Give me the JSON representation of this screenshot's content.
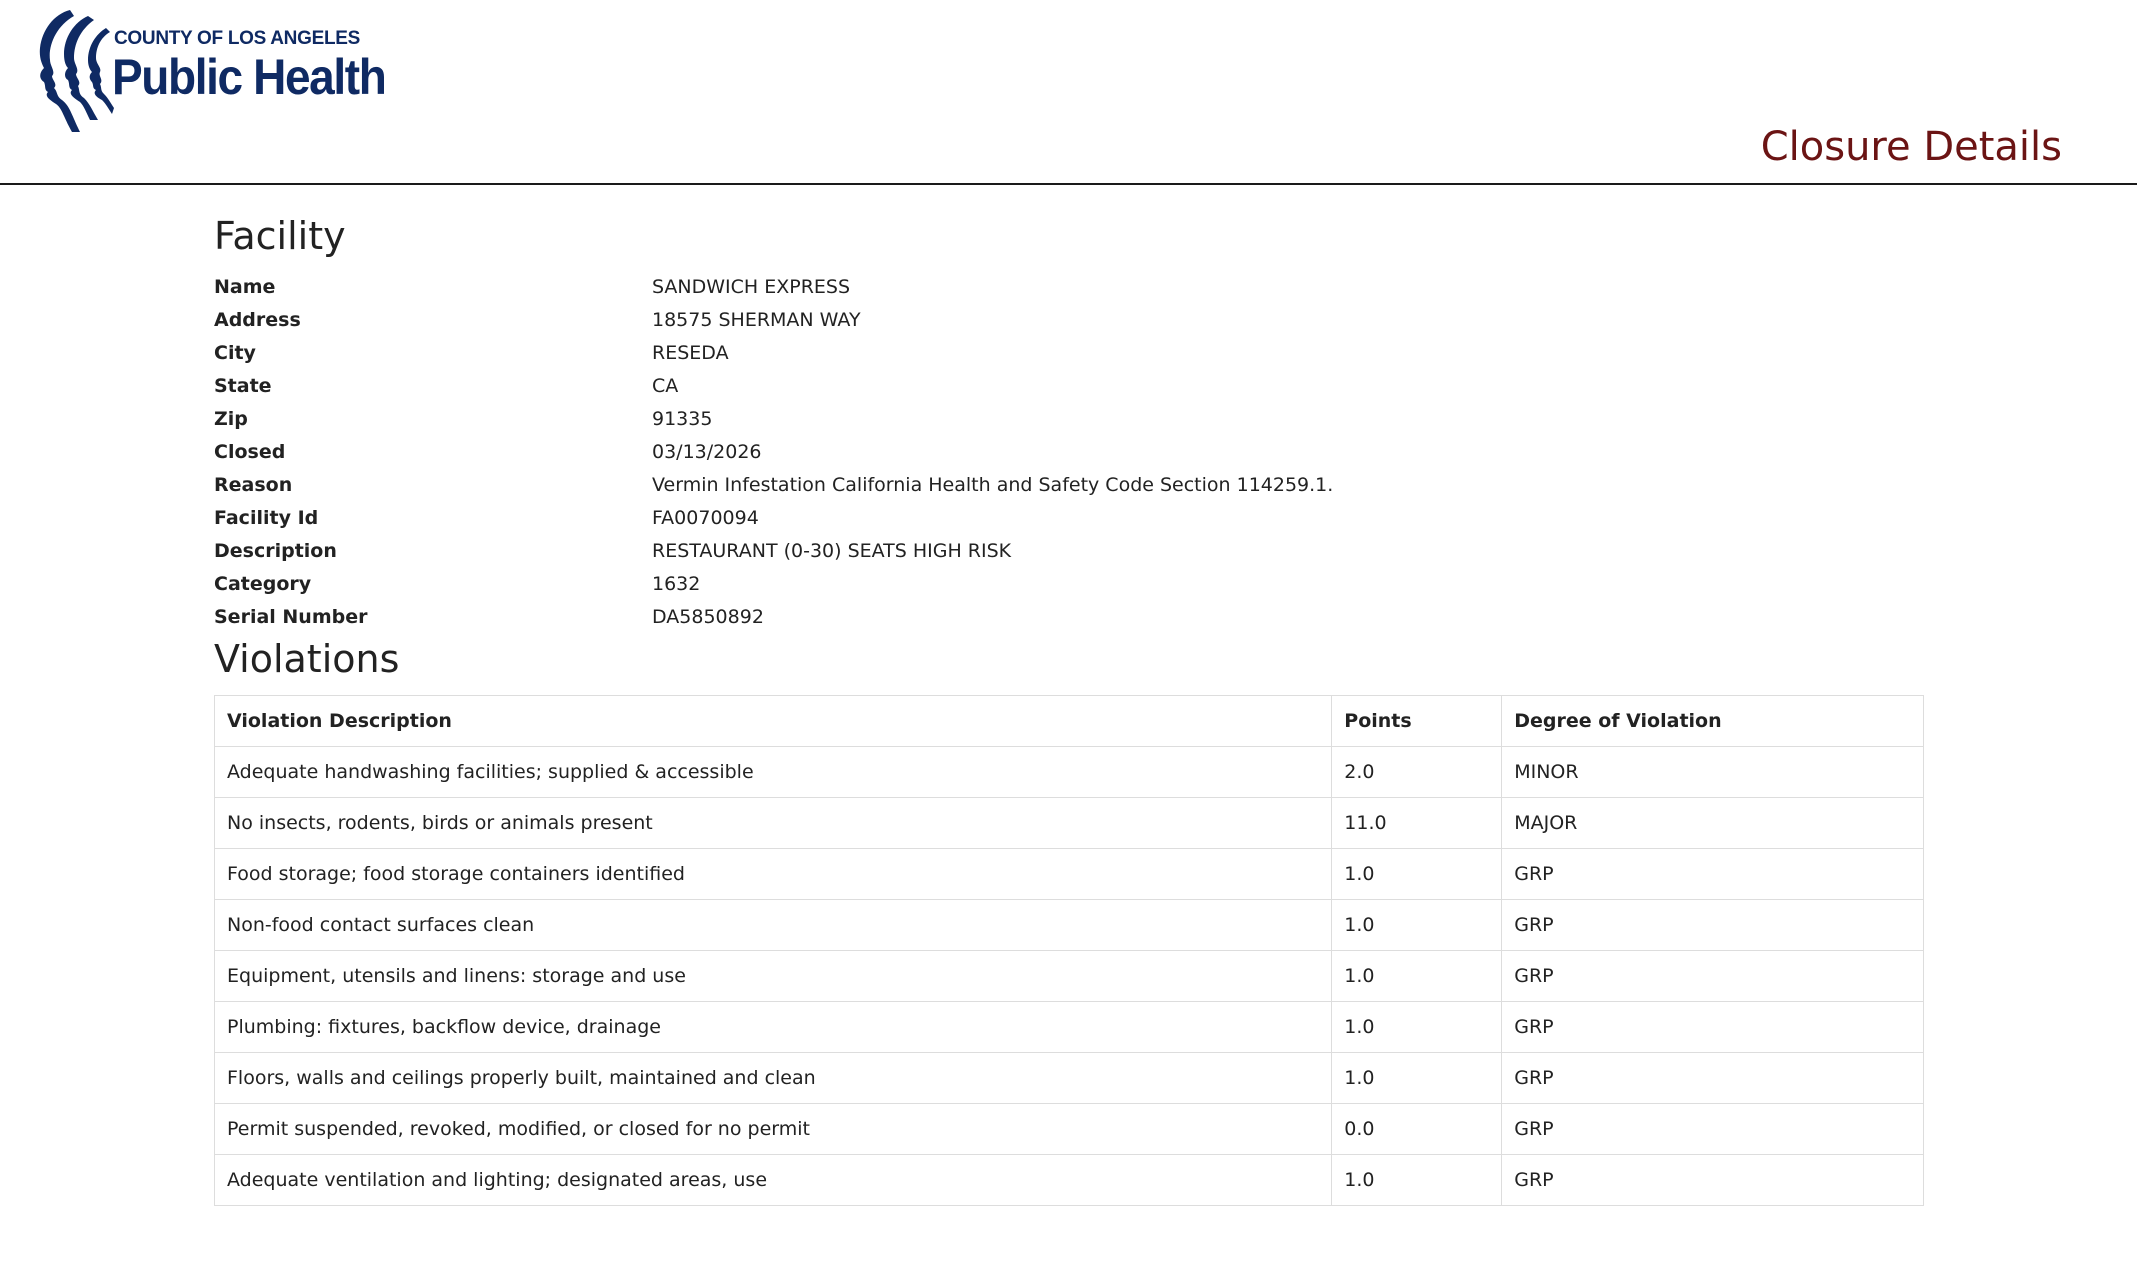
{
  "logo": {
    "county_text": "COUNTY OF LOS ANGELES",
    "name_text": "Public Health"
  },
  "page_title": "Closure Details",
  "facility": {
    "heading": "Facility",
    "fields": [
      {
        "label": "Name",
        "value": "SANDWICH EXPRESS"
      },
      {
        "label": "Address",
        "value": "18575 SHERMAN WAY"
      },
      {
        "label": "City",
        "value": "RESEDA"
      },
      {
        "label": "State",
        "value": "CA"
      },
      {
        "label": "Zip",
        "value": "91335"
      },
      {
        "label": "Closed",
        "value": "03/13/2026"
      },
      {
        "label": "Reason",
        "value": "Vermin Infestation California Health and Safety Code Section 114259.1."
      },
      {
        "label": "Facility Id",
        "value": "FA0070094"
      },
      {
        "label": "Description",
        "value": "RESTAURANT (0-30) SEATS HIGH RISK"
      },
      {
        "label": "Category",
        "value": "1632"
      },
      {
        "label": "Serial Number",
        "value": "DA5850892"
      }
    ]
  },
  "violations": {
    "heading": "Violations",
    "columns": [
      "Violation Description",
      "Points",
      "Degree of Violation"
    ],
    "rows": [
      [
        "Adequate handwashing facilities; supplied & accessible",
        "2.0",
        "MINOR"
      ],
      [
        "No insects, rodents, birds or animals present",
        "11.0",
        "MAJOR"
      ],
      [
        "Food storage; food storage containers identified",
        "1.0",
        "GRP"
      ],
      [
        "Non-food contact surfaces clean",
        "1.0",
        "GRP"
      ],
      [
        "Equipment, utensils and linens: storage and use",
        "1.0",
        "GRP"
      ],
      [
        "Plumbing: fixtures, backflow device, drainage",
        "1.0",
        "GRP"
      ],
      [
        "Floors, walls and ceilings properly built, maintained and clean",
        "1.0",
        "GRP"
      ],
      [
        "Permit suspended, revoked, modified, or closed for no permit",
        "0.0",
        "GRP"
      ],
      [
        "Adequate ventilation and lighting; designated areas, use",
        "1.0",
        "GRP"
      ]
    ]
  },
  "colors": {
    "brand_navy": "#0f2a63",
    "title_red": "#6b1414",
    "table_border": "#dddddd"
  }
}
